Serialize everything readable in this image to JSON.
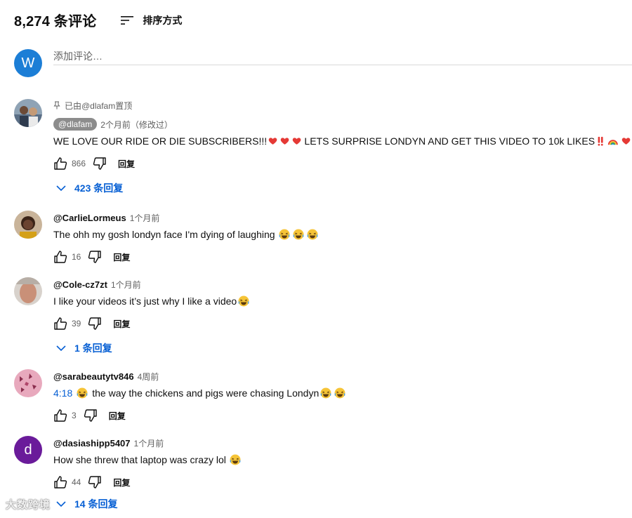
{
  "header": {
    "comment_count": "8,274 条评论",
    "sort_label": "排序方式"
  },
  "add_comment": {
    "avatar_letter": "W",
    "placeholder": "添加评论…"
  },
  "comments": [
    {
      "pinned_label": "已由@dlafam置顶",
      "author": "@dlafam",
      "time": "2个月前（修改过）",
      "text": "WE LOVE OUR RIDE OR DIE SUBSCRIBERS!!!",
      "text2": "LETS SURPRISE LONDYN AND GET THIS VIDEO TO 10k LIKES",
      "likes": "866",
      "reply_label": "回复",
      "replies": "423 条回复"
    },
    {
      "author": "@CarlieLormeus",
      "time": "1个月前",
      "text": "The ohh my gosh londyn face I'm dying of laughing",
      "likes": "16",
      "reply_label": "回复"
    },
    {
      "author": "@Cole-cz7zt",
      "time": "1个月前",
      "text": "I like your videos it’s just why I like a video",
      "likes": "39",
      "reply_label": "回复",
      "replies": "1 条回复"
    },
    {
      "author": "@sarabeautytv846",
      "time": "4周前",
      "timestamp": "4:18",
      "text": "the way the chickens and pigs were chasing Londyn",
      "likes": "3",
      "reply_label": "回复"
    },
    {
      "author": "@dasiashipp5407",
      "avatar_letter": "d",
      "time": "1个月前",
      "text": "How she threw that laptop was crazy lol",
      "likes": "44",
      "reply_label": "回复",
      "replies": "14 条回复"
    }
  ],
  "watermark": "大数跨境",
  "icons": {
    "sort": "sort-icon",
    "pin": "pin-icon",
    "like": "thumbs-up-icon",
    "dislike": "thumbs-down-icon",
    "expand": "chevron-down-icon"
  },
  "colors": {
    "link_blue": "#065fd4",
    "avatar_blue": "#1c7ed6",
    "avatar_purple": "#6a1b9a",
    "chip_gray": "#8c8c8c"
  }
}
